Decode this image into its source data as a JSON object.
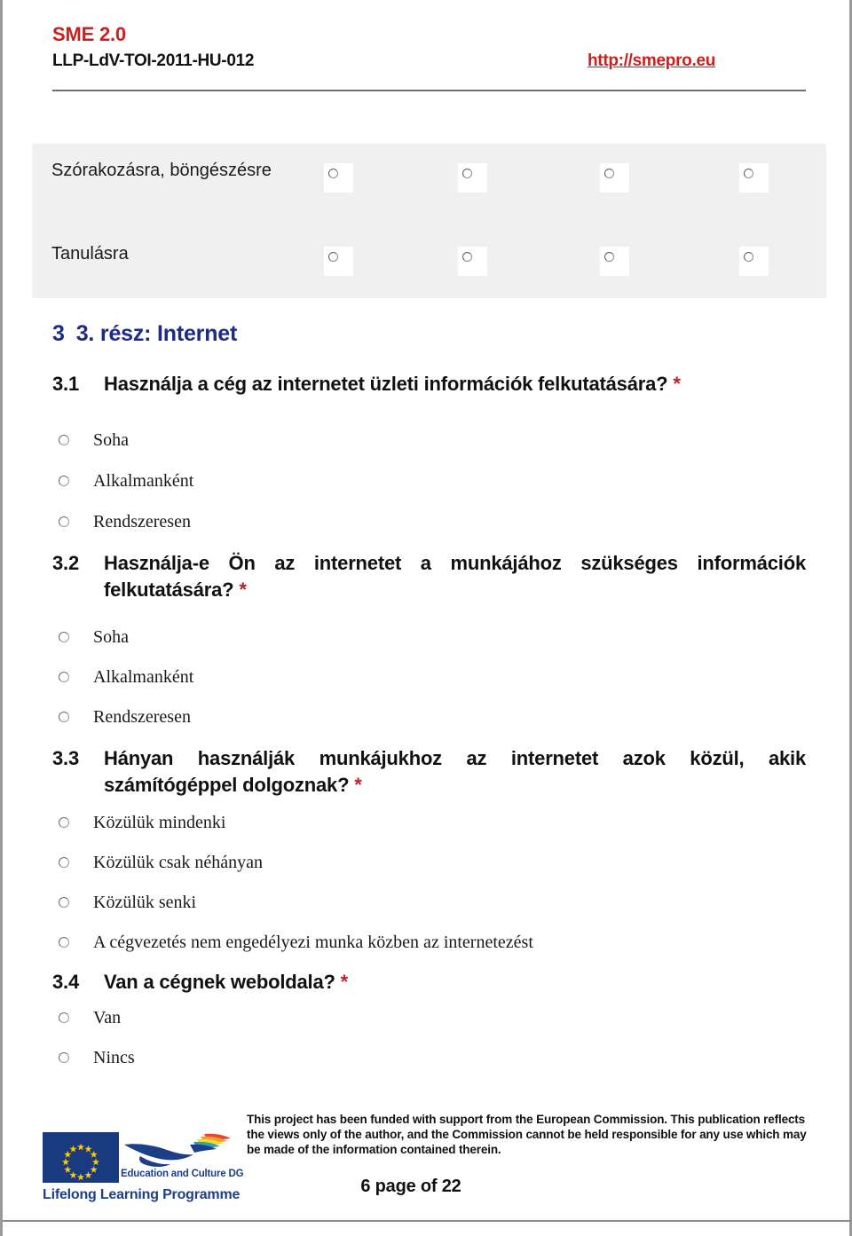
{
  "header": {
    "title": "SME 2.0",
    "project_code": "LLP-LdV-TOI-2011-HU-012",
    "url": "http://smepro.eu",
    "title_color": "#cc1f1f",
    "url_color": "#cc1f1f"
  },
  "matrix": {
    "rows": [
      {
        "label": "Szórakozásra, böngészésre"
      },
      {
        "label": "Tanulásra"
      }
    ],
    "columns": 4,
    "background_color": "#f0f0f0"
  },
  "section": {
    "number": "3",
    "title": "3. rész: Internet",
    "color": "#1d2a86"
  },
  "questions": [
    {
      "number": "3.1",
      "text": "Használja a cég az internetet üzleti információk felkutatására?",
      "required_marker": "*",
      "options": [
        "Soha",
        "Alkalmanként",
        "Rendszeresen"
      ]
    },
    {
      "number": "3.2",
      "text": "Használja-e Ön az internetet a munkájához szükséges információk felkutatására?",
      "required_marker": "*",
      "options": [
        "Soha",
        "Alkalmanként",
        "Rendszeresen"
      ]
    },
    {
      "number": "3.3",
      "text": "Hányan használják munkájukhoz az internetet azok közül, akik számítógéppel dolgoznak?",
      "required_marker": "*",
      "options": [
        "Közülük mindenki",
        "Közülük csak néhányan",
        "Közülük senki",
        "A cégvezetés nem engedélyezi munka közben az internetezést"
      ]
    },
    {
      "number": "3.4",
      "text": "Van a cégnek weboldala?",
      "required_marker": "*",
      "options": [
        "Van",
        "Nincs"
      ]
    }
  ],
  "footer": {
    "disclaimer": "This project has been funded with support from the European Commission. This publication reflects the views only of the author, and the Commission cannot be held responsible for any use which may be made of the information contained therein.",
    "page_indicator": "6 page of 22",
    "logo": {
      "dg_label": "Education and Culture DG",
      "programme_label": "Lifelong Learning Programme",
      "flag_color": "#1a3a80",
      "star_color": "#ffcc00",
      "text_color": "#1d3f87"
    }
  }
}
